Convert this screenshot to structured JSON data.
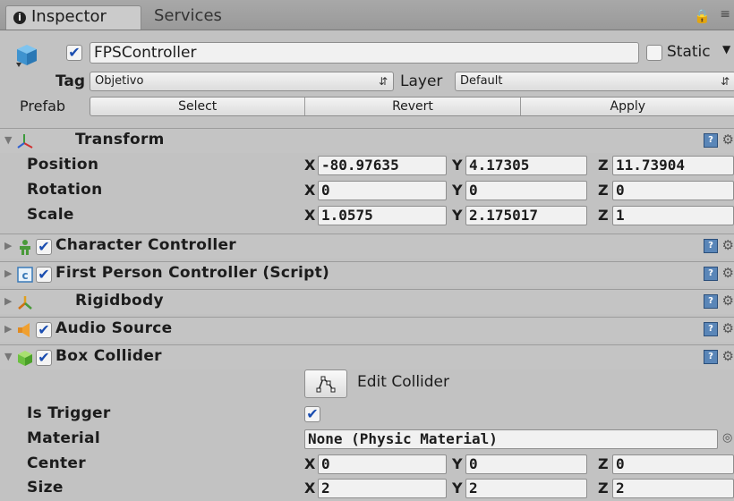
{
  "tabs": {
    "inspector": "Inspector",
    "services": "Services"
  },
  "gameobject": {
    "name": "FPSController",
    "active": true,
    "static_label": "Static",
    "static": false,
    "tag_label": "Tag",
    "tag_value": "Objetivo",
    "layer_label": "Layer",
    "layer_value": "Default"
  },
  "prefab": {
    "label": "Prefab",
    "select": "Select",
    "revert": "Revert",
    "apply": "Apply"
  },
  "transform": {
    "title": "Transform",
    "rows": [
      {
        "label": "Position",
        "x": "-80.97635",
        "y": "4.17305",
        "z": "11.73904"
      },
      {
        "label": "Rotation",
        "x": "0",
        "y": "0",
        "z": "0"
      },
      {
        "label": "Scale",
        "x": "1.0575",
        "y": "2.175017",
        "z": "1"
      }
    ]
  },
  "axes": {
    "x": "X",
    "y": "Y",
    "z": "Z"
  },
  "components": [
    {
      "title": "Character Controller",
      "enabled": true,
      "icon": "character-controller-icon"
    },
    {
      "title": "First Person Controller (Script)",
      "enabled": true,
      "icon": "script-icon"
    },
    {
      "title": "Rigidbody",
      "enabled": null,
      "icon": "rigidbody-icon"
    },
    {
      "title": "Audio Source",
      "enabled": true,
      "icon": "audio-source-icon"
    }
  ],
  "box_collider": {
    "title": "Box Collider",
    "enabled": true,
    "edit_collider_label": "Edit Collider",
    "is_trigger_label": "Is Trigger",
    "is_trigger": true,
    "material_label": "Material",
    "material_value": "None (Physic Material)",
    "center": {
      "label": "Center",
      "x": "0",
      "y": "0",
      "z": "0"
    },
    "size": {
      "label": "Size",
      "x": "2",
      "y": "2",
      "z": "2"
    }
  },
  "colors": {
    "panel_bg": "#c2c2c2",
    "field_bg": "#f1f1f1",
    "check_blue": "#1a4db0",
    "help_blue": "#5a86b8"
  }
}
